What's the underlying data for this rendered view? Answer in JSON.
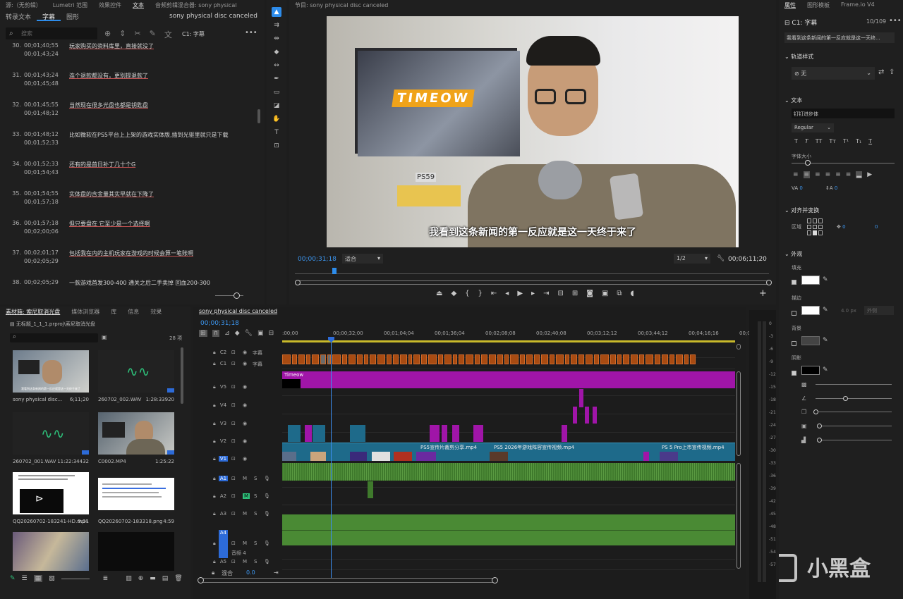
{
  "source_panel": {
    "tabs": [
      "源:（无剪辑）",
      "Lumetri 范围",
      "效果控件",
      "文本",
      "音频剪辑混合器: sony physical"
    ],
    "active_tab": "文本",
    "subtabs": [
      "转录文本",
      "字幕",
      "图形"
    ],
    "active_subtab": "字幕",
    "sequence_name": "sony physical disc canceled",
    "search_placeholder": "搜索",
    "track_label": "C1: 字幕"
  },
  "transcript": [
    {
      "no": "30.",
      "t1": "00;01;40;55",
      "t2": "00;01;43;24",
      "text": "玩家购买的资料库里，直接就没了"
    },
    {
      "no": "31.",
      "t1": "00;01;43;24",
      "t2": "00;01;45;48",
      "text": "连个退款都没有，更别提退款了"
    },
    {
      "no": "32.",
      "t1": "00;01;45;55",
      "t2": "00;01;48;12",
      "text": "当然现在很多光盘也都是钥匙盘"
    },
    {
      "no": "33.",
      "t1": "00;01;48;12",
      "t2": "00;01;52;33",
      "text": "比如微软在PS5平台上上架的游戏实体版,插到光驱里就只是下载"
    },
    {
      "no": "34.",
      "t1": "00;01;52;33",
      "t2": "00;01;54;43",
      "text": "还有的是首日补丁几十个G"
    },
    {
      "no": "35.",
      "t1": "00;01;54;55",
      "t2": "00;01;57;18",
      "text": "实体盘的含金量其实早就在下降了"
    },
    {
      "no": "36.",
      "t1": "00;01;57;18",
      "t2": "00;02;00;06",
      "text": "但只要盘在 它至少是一个选择啊"
    },
    {
      "no": "37.",
      "t1": "00;02;01;17",
      "t2": "00;02;05;29",
      "text": "包括我在内的主机玩家在游戏的时候会算一笔账啊"
    },
    {
      "no": "38.",
      "t1": "00;02;05;29",
      "t2": "",
      "text": "一款游戏首发300-400 通关之后二手卖掉 回血200-300"
    }
  ],
  "program": {
    "title": "节目: sony physical disc canceled",
    "timecode": "00;00;31;18",
    "fit": "适合",
    "resolution": "1/2",
    "duration": "00;06;11;20",
    "subtitle": "我看到这条新闻的第一反应就是这一天终于来了",
    "screen_logo": "TIMEOW",
    "keyboard_label": "PS59"
  },
  "project": {
    "tabs": [
      "素材箱: 索尼取消光盘",
      "媒体浏览器",
      "库",
      "信息",
      "效果"
    ],
    "path": "无标题_1_1_1.prproj\\索尼取消光盘",
    "count": "28 项",
    "items": [
      {
        "name": "sony physical disc...",
        "dur": "6;11;20",
        "caption": "我看到这条新闻的第一反应就是这一天终于来了"
      },
      {
        "name": "260702_002.WAV",
        "dur": "1:28:33920"
      },
      {
        "name": "260702_001.WAV",
        "dur": "11:22:34432"
      },
      {
        "name": "C0002.MP4",
        "dur": "1:25:22"
      },
      {
        "name": "QQ20260702-183241-HD.mp4",
        "dur": "9:21"
      },
      {
        "name": "QQ20260702-183318.png",
        "dur": "4:59"
      }
    ]
  },
  "timeline": {
    "title": "sony physical disc canceled",
    "timecode": "00;00;31;18",
    "ruler": [
      ":00;00",
      "00;00;32;00",
      "00;01;04;04",
      "00;01;36;04",
      "00;02;08;08",
      "00;02;40;08",
      "00;03;12;12",
      "00;03;44;12",
      "00;04;16;16",
      "00;04;"
    ],
    "tracks": [
      {
        "id": "C2",
        "name": "字幕"
      },
      {
        "id": "C1",
        "name": "字幕"
      },
      {
        "id": "V5"
      },
      {
        "id": "V4"
      },
      {
        "id": "V3"
      },
      {
        "id": "V2"
      },
      {
        "id": "V1"
      },
      {
        "id": "A1",
        "m": "M",
        "s": "S"
      },
      {
        "id": "A2",
        "m": "M",
        "s": "S"
      },
      {
        "id": "A3",
        "m": "M",
        "s": "S"
      },
      {
        "id": "A4",
        "m": "M",
        "s": "S",
        "name": "音频 4"
      },
      {
        "id": "A5",
        "m": "M",
        "s": "S"
      }
    ],
    "mix_label": "混合",
    "mix_value": "0.0",
    "clip_labels": {
      "v5": "Timeow",
      "v1a": "PS5宣传片裁剪分享.mp4",
      "v1b": "PS5 2026年游戏阵容宣传视频.mp4",
      "v1c": "PS 5 Pro上市宣传视频.mp4"
    }
  },
  "meter_scale": [
    "0",
    "-3",
    "-6",
    "-9",
    "-12",
    "-15",
    "-18",
    "-21",
    "-24",
    "-27",
    "-30",
    "-33",
    "-36",
    "-39",
    "-42",
    "-45",
    "-48",
    "-51",
    "-54",
    "-57"
  ],
  "props": {
    "tabs": [
      "属性",
      "图形模板",
      "Frame.io V4"
    ],
    "layer": "C1: 字幕",
    "counter": "10/109",
    "text_preview": "我看到这条新闻的第一反应就是这一天终...",
    "track_style_title": "轨道样式",
    "track_style_value": "无",
    "text_title": "文本",
    "font": "钉钉进步体",
    "weight": "Regular",
    "font_size_label": "字体大小",
    "align_title": "对齐并变换",
    "region_label": "区域",
    "pos_x": "0",
    "pos_y": "0",
    "appearance_title": "外观",
    "fill": "填充",
    "stroke": "描边",
    "stroke_px": "4.0 px",
    "stroke_out": "外侧",
    "bg": "背景",
    "shadow": "阴影",
    "tracking": "0",
    "leading": "0"
  },
  "watermark": "小黑盒",
  "colors": {
    "accent": "#2d8ceb",
    "clip_purple": "#a015a8",
    "clip_blue": "#1e6a8a",
    "clip_orange": "#a84b12",
    "clip_green": "#3f7a2c"
  }
}
